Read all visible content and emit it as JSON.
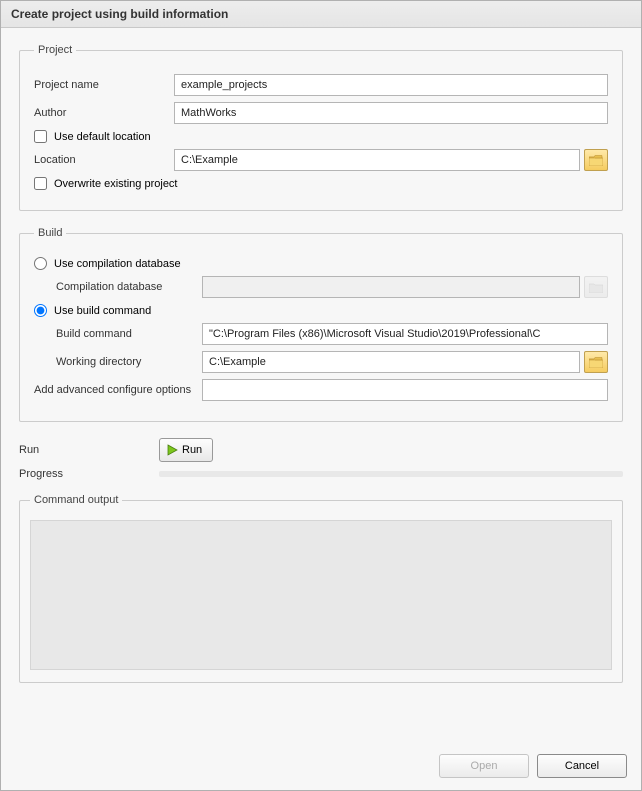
{
  "window": {
    "title": "Create project using build information"
  },
  "project": {
    "legend": "Project",
    "name_label": "Project name",
    "name_value": "example_projects",
    "author_label": "Author",
    "author_value": "MathWorks",
    "use_default_location_label": "Use default location",
    "use_default_location_checked": false,
    "location_label": "Location",
    "location_value": "C:\\Example",
    "overwrite_label": "Overwrite existing project",
    "overwrite_checked": false
  },
  "build": {
    "legend": "Build",
    "use_compilation_db_label": "Use compilation database",
    "use_compilation_db_selected": false,
    "compilation_db_label": "Compilation database",
    "compilation_db_value": "",
    "use_build_command_label": "Use build command",
    "use_build_command_selected": true,
    "build_command_label": "Build command",
    "build_command_value": "\"C:\\Program Files (x86)\\Microsoft Visual Studio\\2019\\Professional\\C",
    "working_dir_label": "Working directory",
    "working_dir_value": "C:\\Example",
    "advanced_options_label": "Add advanced configure options",
    "advanced_options_value": ""
  },
  "run": {
    "label": "Run",
    "button_label": "Run",
    "progress_label": "Progress"
  },
  "command_output": {
    "legend": "Command output"
  },
  "footer": {
    "open_label": "Open",
    "cancel_label": "Cancel"
  }
}
